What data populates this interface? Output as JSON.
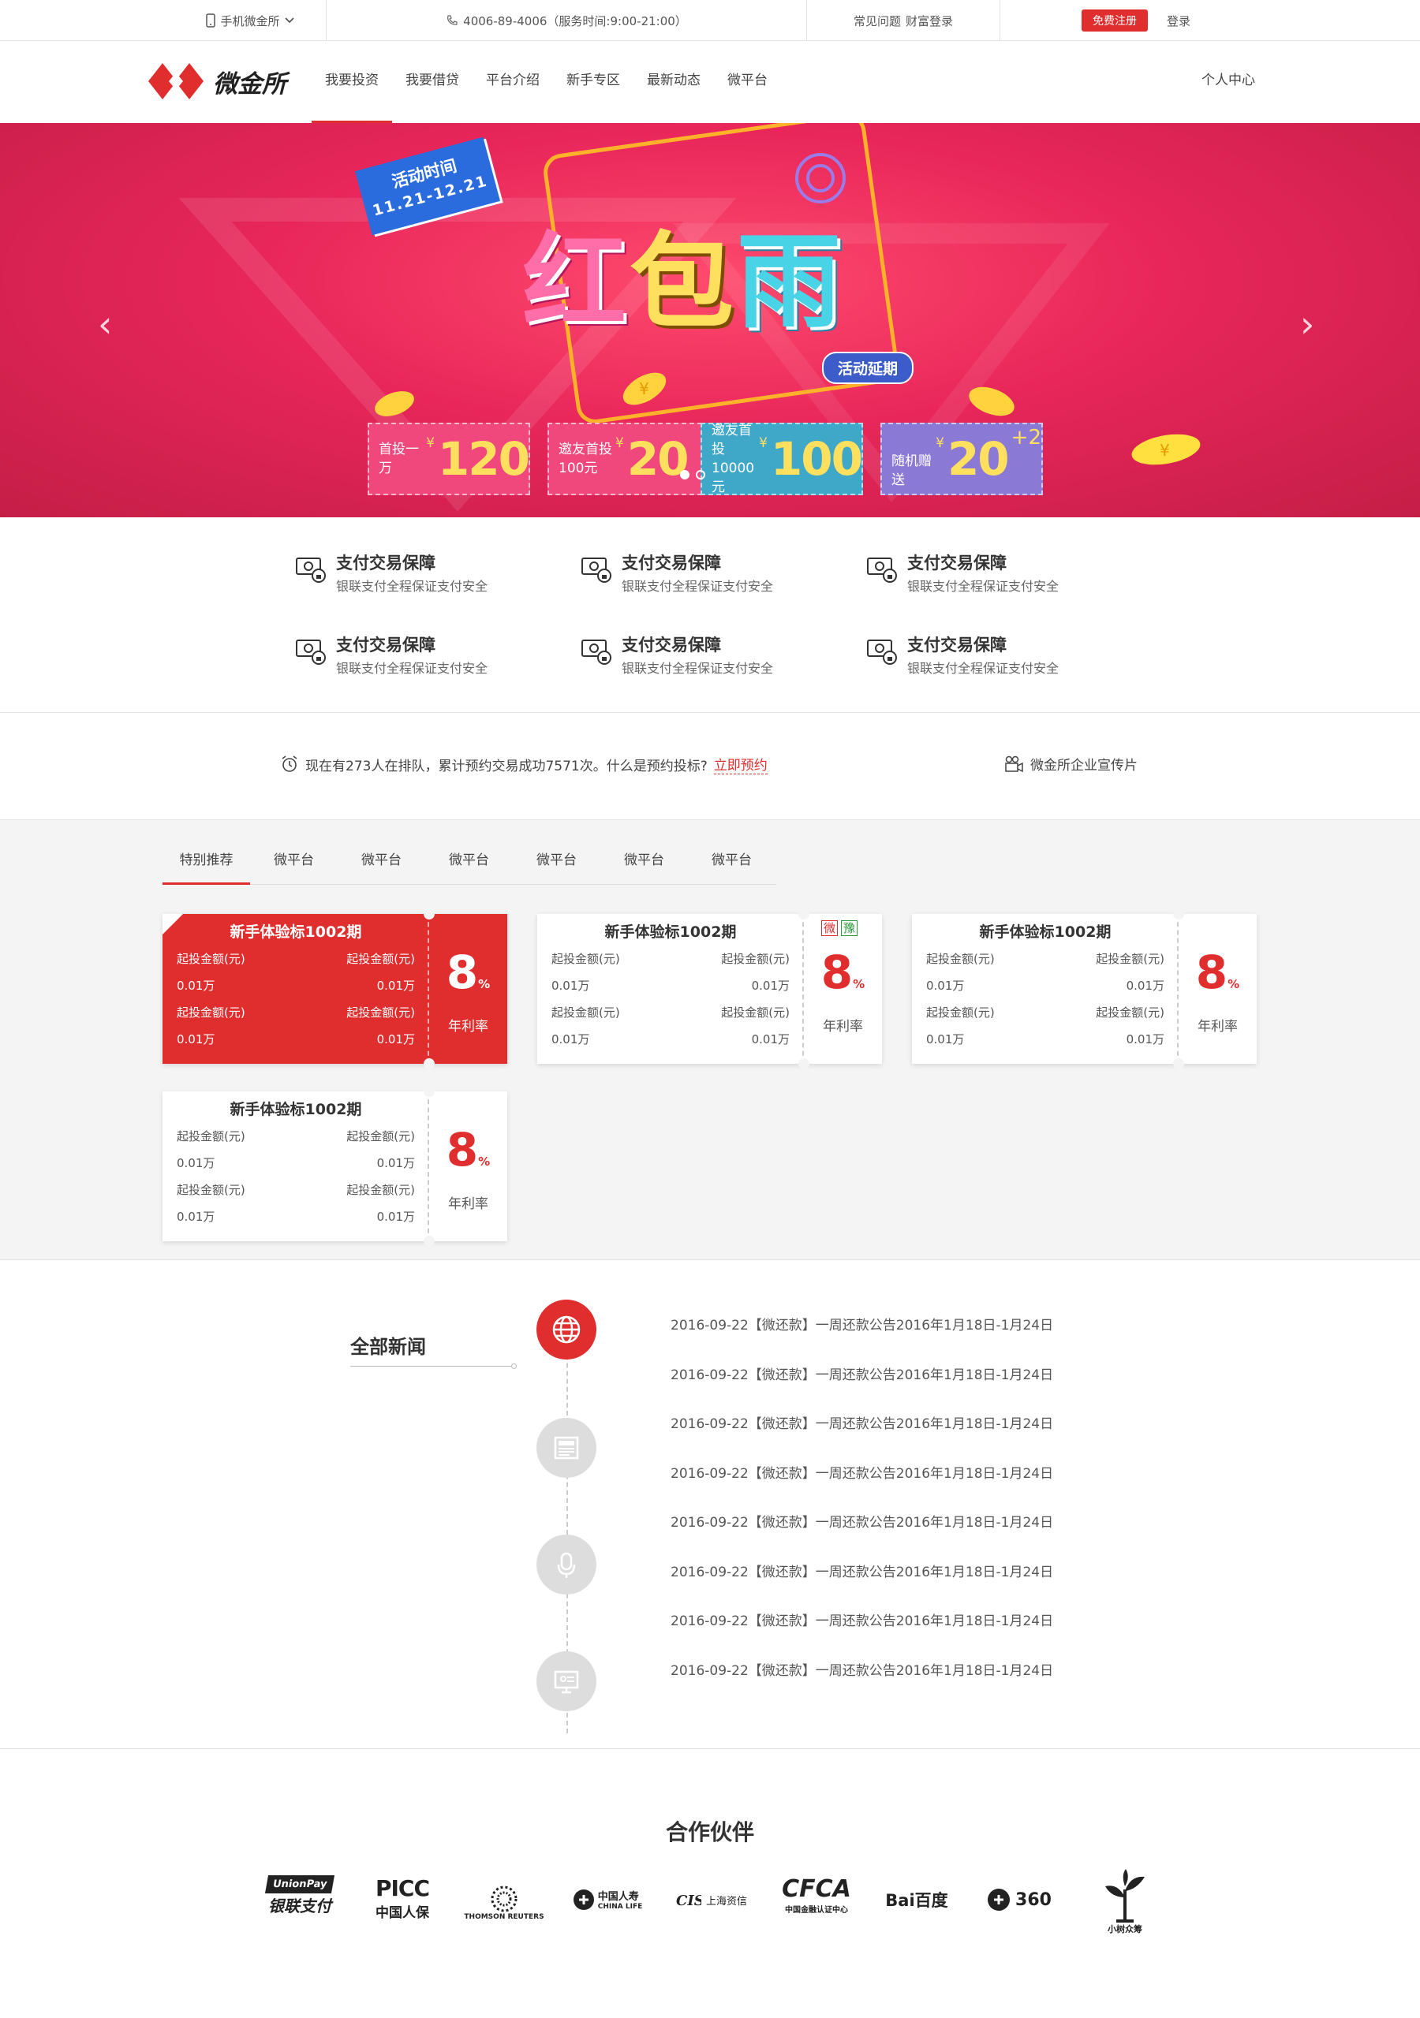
{
  "topbar": {
    "mobile": "手机微金所",
    "phone": "4006-89-4006（服务时间:9:00-21:00）",
    "faq": "常见问题",
    "wealth_login": "财富登录",
    "register": "免费注册",
    "login": "登录"
  },
  "nav": {
    "logo_text": "微金所",
    "items": [
      "我要投资",
      "我要借贷",
      "平台介绍",
      "新手专区",
      "最新动态",
      "微平台"
    ],
    "personal": "个人中心"
  },
  "banner": {
    "time_label": "活动时间",
    "time_range": "11.21-12.21",
    "title": [
      "红",
      "包",
      "雨"
    ],
    "delay_badge": "活动延期",
    "coupons": [
      {
        "label": "首投一万",
        "label2": "",
        "value": "120",
        "plus": "",
        "color": "#f0477d"
      },
      {
        "label": "邀友首投",
        "label2": "100元",
        "value": "20",
        "plus": "",
        "color": "#f0477d"
      },
      {
        "label": "邀友首投",
        "label2": "10000元",
        "value": "100",
        "plus": "",
        "color": "#3fa8c9"
      },
      {
        "label": "随机赠送",
        "label2": "",
        "value": "20",
        "plus": "+2",
        "color": "#8b79d6"
      }
    ],
    "currency": "¥"
  },
  "features": [
    {
      "title": "支付交易保障",
      "desc": "银联支付全程保证支付安全"
    },
    {
      "title": "支付交易保障",
      "desc": "银联支付全程保证支付安全"
    },
    {
      "title": "支付交易保障",
      "desc": "银联支付全程保证支付安全"
    },
    {
      "title": "支付交易保障",
      "desc": "银联支付全程保证支付安全"
    },
    {
      "title": "支付交易保障",
      "desc": "银联支付全程保证支付安全"
    },
    {
      "title": "支付交易保障",
      "desc": "银联支付全程保证支付安全"
    }
  ],
  "queue": {
    "text": "现在有273人在排队，累计预约交易成功7571次。什么是预约投标?",
    "link": "立即预约",
    "video": "微金所企业宣传片"
  },
  "products": {
    "tabs": [
      "特别推荐",
      "微平台",
      "微平台",
      "微平台",
      "微平台",
      "微平台",
      "微平台"
    ],
    "cards": [
      {
        "title": "新手体验标1002期",
        "k1": "起投金额(元)",
        "k2": "起投金额(元)",
        "v1": "0.01万",
        "v2": "0.01万",
        "k3": "起投金额(元)",
        "k4": "起投金额(元)",
        "v3": "0.01万",
        "v4": "0.01万",
        "rate": "8",
        "pct": "%",
        "rate_label": "年利率",
        "badges": []
      },
      {
        "title": "新手体验标1002期",
        "k1": "起投金额(元)",
        "k2": "起投金额(元)",
        "v1": "0.01万",
        "v2": "0.01万",
        "k3": "起投金额(元)",
        "k4": "起投金额(元)",
        "v3": "0.01万",
        "v4": "0.01万",
        "rate": "8",
        "pct": "%",
        "rate_label": "年利率",
        "badges": [
          "微",
          "豫"
        ]
      },
      {
        "title": "新手体验标1002期",
        "k1": "起投金额(元)",
        "k2": "起投金额(元)",
        "v1": "0.01万",
        "v2": "0.01万",
        "k3": "起投金额(元)",
        "k4": "起投金额(元)",
        "v3": "0.01万",
        "v4": "0.01万",
        "rate": "8",
        "pct": "%",
        "rate_label": "年利率",
        "badges": []
      },
      {
        "title": "新手体验标1002期",
        "k1": "起投金额(元)",
        "k2": "起投金额(元)",
        "v1": "0.01万",
        "v2": "0.01万",
        "k3": "起投金额(元)",
        "k4": "起投金额(元)",
        "v3": "0.01万",
        "v4": "0.01万",
        "rate": "8",
        "pct": "%",
        "rate_label": "年利率",
        "badges": []
      }
    ]
  },
  "news": {
    "title": "全部新闻",
    "items": [
      "2016-09-22【微还款】一周还款公告2016年1月18日-1月24日",
      "2016-09-22【微还款】一周还款公告2016年1月18日-1月24日",
      "2016-09-22【微还款】一周还款公告2016年1月18日-1月24日",
      "2016-09-22【微还款】一周还款公告2016年1月18日-1月24日",
      "2016-09-22【微还款】一周还款公告2016年1月18日-1月24日",
      "2016-09-22【微还款】一周还款公告2016年1月18日-1月24日",
      "2016-09-22【微还款】一周还款公告2016年1月18日-1月24日",
      "2016-09-22【微还款】一周还款公告2016年1月18日-1月24日"
    ],
    "icons": [
      "globe-icon",
      "newspaper-icon",
      "microphone-icon",
      "monitor-icon"
    ]
  },
  "partners": {
    "title": "合作伙伴",
    "logos": [
      {
        "name": "unionpay-logo",
        "text": "银联支付",
        "sub": "UnionPay"
      },
      {
        "name": "picc-logo",
        "text": "PICC",
        "sub": "中国人保"
      },
      {
        "name": "thomson-reuters-logo",
        "text": "THOMSON REUTERS",
        "sub": ""
      },
      {
        "name": "china-life-logo",
        "text": "中国人寿",
        "sub": "CHINA LIFE"
      },
      {
        "name": "shanghai-credit-logo",
        "text": "上海资信",
        "sub": ""
      },
      {
        "name": "cfca-logo",
        "text": "CFCA",
        "sub": "中国金融认证中心"
      },
      {
        "name": "baidu-logo",
        "text": "Bai百度",
        "sub": ""
      },
      {
        "name": "360-logo",
        "text": "360",
        "sub": ""
      },
      {
        "name": "sprout-logo",
        "text": "小树众筹",
        "sub": ""
      }
    ]
  }
}
